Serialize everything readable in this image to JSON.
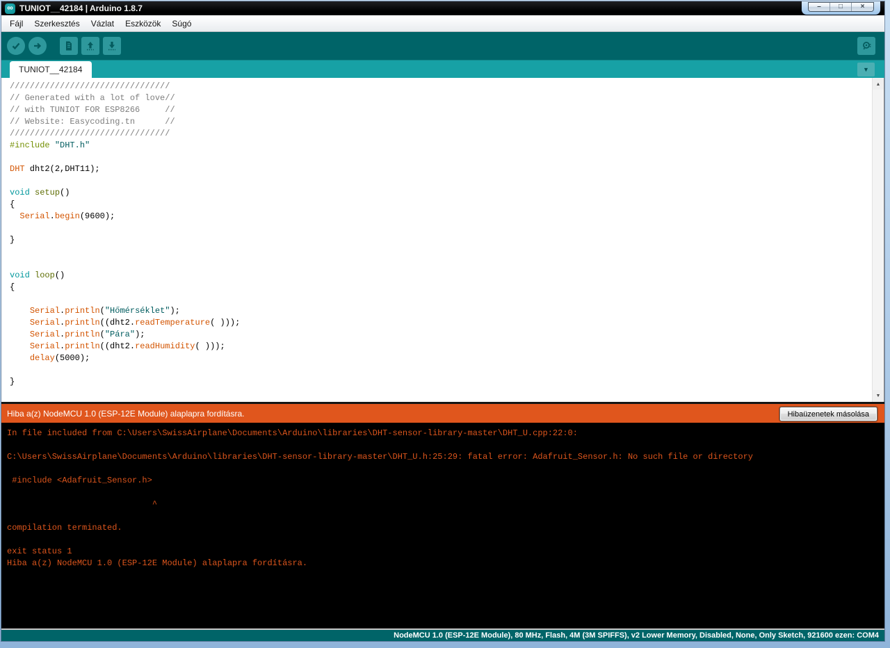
{
  "window": {
    "title": "TUNIOT__42184 | Arduino 1.8.7",
    "icon_glyph": "∞",
    "controls": {
      "minimize": "–",
      "maximize": "□",
      "close": "×"
    }
  },
  "menu": {
    "items": [
      "Fájl",
      "Szerkesztés",
      "Vázlat",
      "Eszközök",
      "Súgó"
    ]
  },
  "toolbar": {
    "buttons": [
      "verify",
      "upload",
      "new-sketch",
      "open-sketch",
      "save-sketch",
      "serial-monitor"
    ]
  },
  "icons": {
    "dropdown": "▼",
    "scroll_up": "▲",
    "scroll_down": "▼"
  },
  "tabs": {
    "active": "TUNIOT__42184"
  },
  "editor": {
    "code_lines": [
      [
        {
          "t": "////////////////////////////////",
          "c": "comment"
        }
      ],
      [
        {
          "t": "// Generated with a lot of love//",
          "c": "comment"
        }
      ],
      [
        {
          "t": "// with TUNIOT FOR ESP8266     //",
          "c": "comment"
        }
      ],
      [
        {
          "t": "// Website: Easycoding.tn      //",
          "c": "comment"
        }
      ],
      [
        {
          "t": "////////////////////////////////",
          "c": "comment"
        }
      ],
      [
        {
          "t": "#include ",
          "c": "preproc"
        },
        {
          "t": "\"DHT.h\"",
          "c": "string"
        }
      ],
      [],
      [
        {
          "t": "DHT",
          "c": "classname"
        },
        {
          "t": " dht2(2,DHT11);",
          "c": "plain"
        }
      ],
      [],
      [
        {
          "t": "void",
          "c": "keyword"
        },
        {
          "t": " ",
          "c": "plain"
        },
        {
          "t": "setup",
          "c": "func"
        },
        {
          "t": "()",
          "c": "plain"
        }
      ],
      [
        {
          "t": "{",
          "c": "plain"
        }
      ],
      [
        {
          "t": "  ",
          "c": "plain"
        },
        {
          "t": "Serial",
          "c": "builtin"
        },
        {
          "t": ".",
          "c": "plain"
        },
        {
          "t": "begin",
          "c": "builtin"
        },
        {
          "t": "(9600);",
          "c": "plain"
        }
      ],
      [],
      [
        {
          "t": "}",
          "c": "plain"
        }
      ],
      [],
      [],
      [
        {
          "t": "void",
          "c": "keyword"
        },
        {
          "t": " ",
          "c": "plain"
        },
        {
          "t": "loop",
          "c": "func"
        },
        {
          "t": "()",
          "c": "plain"
        }
      ],
      [
        {
          "t": "{",
          "c": "plain"
        }
      ],
      [],
      [
        {
          "t": "    ",
          "c": "plain"
        },
        {
          "t": "Serial",
          "c": "builtin"
        },
        {
          "t": ".",
          "c": "plain"
        },
        {
          "t": "println",
          "c": "builtin"
        },
        {
          "t": "(",
          "c": "plain"
        },
        {
          "t": "\"Hőmérséklet\"",
          "c": "string"
        },
        {
          "t": ");",
          "c": "plain"
        }
      ],
      [
        {
          "t": "    ",
          "c": "plain"
        },
        {
          "t": "Serial",
          "c": "builtin"
        },
        {
          "t": ".",
          "c": "plain"
        },
        {
          "t": "println",
          "c": "builtin"
        },
        {
          "t": "((dht2.",
          "c": "plain"
        },
        {
          "t": "readTemperature",
          "c": "builtin"
        },
        {
          "t": "( )));",
          "c": "plain"
        }
      ],
      [
        {
          "t": "    ",
          "c": "plain"
        },
        {
          "t": "Serial",
          "c": "builtin"
        },
        {
          "t": ".",
          "c": "plain"
        },
        {
          "t": "println",
          "c": "builtin"
        },
        {
          "t": "(",
          "c": "plain"
        },
        {
          "t": "\"Pára\"",
          "c": "string"
        },
        {
          "t": ");",
          "c": "plain"
        }
      ],
      [
        {
          "t": "    ",
          "c": "plain"
        },
        {
          "t": "Serial",
          "c": "builtin"
        },
        {
          "t": ".",
          "c": "plain"
        },
        {
          "t": "println",
          "c": "builtin"
        },
        {
          "t": "((dht2.",
          "c": "plain"
        },
        {
          "t": "readHumidity",
          "c": "builtin"
        },
        {
          "t": "( )));",
          "c": "plain"
        }
      ],
      [
        {
          "t": "    ",
          "c": "plain"
        },
        {
          "t": "delay",
          "c": "builtin"
        },
        {
          "t": "(5000);",
          "c": "plain"
        }
      ],
      [],
      [
        {
          "t": "}",
          "c": "plain"
        }
      ]
    ]
  },
  "error_bar": {
    "message": "Hiba a(z) NodeMCU 1.0 (ESP-12E Module) alaplapra fordításra.",
    "copy_button": "Hibaüzenetek másolása"
  },
  "console": {
    "lines": [
      "In file included from C:\\Users\\SwissAirplane\\Documents\\Arduino\\libraries\\DHT-sensor-library-master\\DHT_U.cpp:22:0:",
      "",
      "C:\\Users\\SwissAirplane\\Documents\\Arduino\\libraries\\DHT-sensor-library-master\\DHT_U.h:25:29: fatal error: Adafruit_Sensor.h: No such file or directory",
      "",
      " #include <Adafruit_Sensor.h>",
      "",
      "                             ^",
      "",
      "compilation terminated.",
      "",
      "exit status 1",
      "Hiba a(z) NodeMCU 1.0 (ESP-12E Module) alaplapra fordításra."
    ]
  },
  "status_bar": {
    "text": "NodeMCU 1.0 (ESP-12E Module), 80 MHz, Flash, 4M (3M SPIFFS), v2 Lower Memory, Disabled, None, Only Sketch, 921600 ezen: COM4"
  },
  "colors": {
    "toolbar_teal": "#006468",
    "tabstrip_teal": "#17A1A5",
    "button_teal": "#2E989C",
    "error_orange": "#E0561D",
    "console_text_orange": "#DC551C",
    "titlebar_black": "#000000",
    "keyword_teal": "#00979C",
    "function_olive": "#5E6D03",
    "preprocessor_green": "#728E00",
    "string_teal": "#005C5F",
    "builtin_orange": "#D35400",
    "comment_gray": "#7E7E7E"
  }
}
